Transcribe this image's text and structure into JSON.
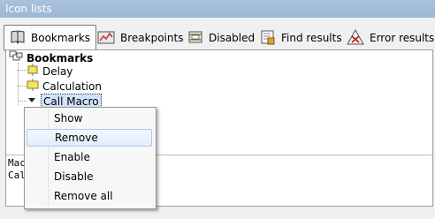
{
  "window": {
    "title": "Icon lists"
  },
  "tabs": [
    {
      "label": "Bookmarks",
      "icon": "book-icon",
      "active": true
    },
    {
      "label": "Breakpoints",
      "icon": "breakpoints-icon",
      "active": false
    },
    {
      "label": "Disabled",
      "icon": "disabled-icon",
      "active": false
    },
    {
      "label": "Find results",
      "icon": "find-results-icon",
      "active": false
    },
    {
      "label": "Error results",
      "icon": "error-results-icon",
      "active": false
    }
  ],
  "tree": {
    "root": "Bookmarks",
    "children": [
      {
        "label": "Delay",
        "icon": "macro-step-icon"
      },
      {
        "label": "Calculation",
        "icon": "macro-step-icon"
      },
      {
        "label": "Call Macro",
        "icon": "arrow-down-icon",
        "selected": true
      }
    ]
  },
  "output": {
    "lines": [
      "Mac",
      "Cal"
    ]
  },
  "context_menu": {
    "items": [
      {
        "label": "Show"
      },
      {
        "label": "Remove",
        "hover": true
      },
      {
        "label": "Enable"
      },
      {
        "label": "Disable"
      },
      {
        "label": "Remove all"
      }
    ]
  },
  "colors": {
    "titlebar": "#a9c2dd",
    "selection": "#cfe3fb",
    "menu_hover": "#e2edfb"
  }
}
